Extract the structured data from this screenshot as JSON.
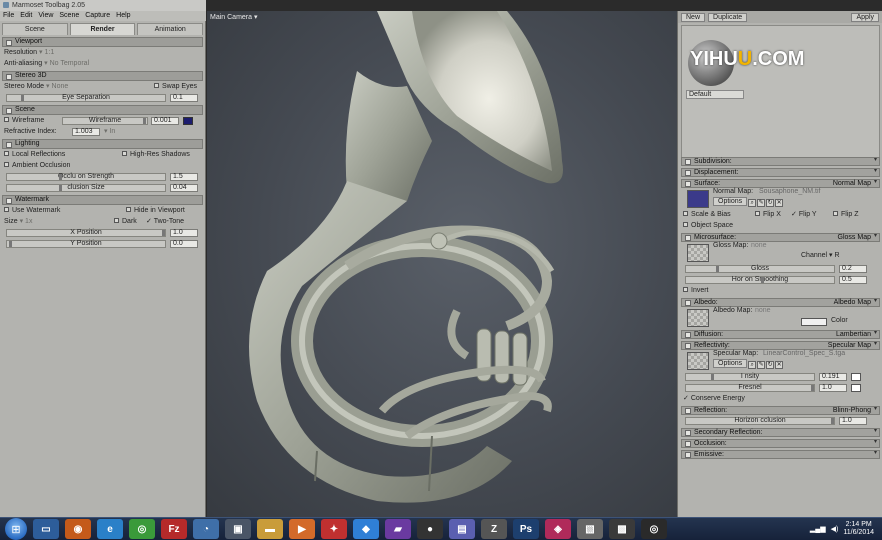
{
  "window": {
    "title": "Marmoset Toolbag 2.05"
  },
  "menu": [
    "File",
    "Edit",
    "View",
    "Scene",
    "Capture",
    "Help"
  ],
  "left_tabs": [
    {
      "label": "Scene",
      "active": false
    },
    {
      "label": "Render",
      "active": true
    },
    {
      "label": "Animation",
      "active": false
    }
  ],
  "viewport_section": {
    "header": "Viewport",
    "resolution_label": "Resolution",
    "resolution_value": "1:1",
    "antialias_label": "Anti-aliasing",
    "antialias_value": "No Temporal"
  },
  "stereo": {
    "header": "Stereo 3D",
    "mode_label": "Stereo Mode",
    "mode_value": "None",
    "swap_eyes": "Swap Eyes",
    "eye_sep_label": "Eye Separation",
    "eye_sep_value": "0.1"
  },
  "scene": {
    "header": "Scene",
    "wireframe_label": "Wireframe",
    "wireframe_field": "Wireframe",
    "wireframe_value": "0.001",
    "wire_color": "#1c1c6e",
    "refractive_label": "Refractive Index:",
    "refractive_value": "1.003",
    "refractive_unit": "In"
  },
  "lighting": {
    "header": "Lighting",
    "local_reflections": "Local Reflections",
    "high_res_shadows": "High-Res Shadows",
    "ambient_occlusion": "Ambient Occlusion",
    "occlusion_strength_label": "Occlu   on Strength",
    "occlusion_strength_value": "1.5",
    "occlusion_size_label": "   clusion Size",
    "occlusion_size_value": "0.04"
  },
  "watermark": {
    "header": "Watermark",
    "use_watermark": "Use Watermark",
    "hide_viewport": "Hide in Viewport",
    "size_label": "Size",
    "size_value": "1x",
    "dark": "Dark",
    "two_tone": "Two-Tone",
    "x_label": "X Position",
    "x_value": "1.0",
    "y_label": "Y Position",
    "y_value": "0.0"
  },
  "viewport_label": "Main Camera",
  "material_toolbar": {
    "new": "New",
    "duplicate": "Duplicate",
    "apply": "Apply"
  },
  "watermark_logo": {
    "part1": "YI",
    "part2": "HU",
    "part3": "U",
    "part4": ".COM"
  },
  "material_name": "Default",
  "sections": {
    "subdivision": "Subdivision:",
    "displacement": "Displacement:",
    "surface": "Surface:",
    "surface_mode": "Normal Map",
    "normal_map_label": "Normal Map:",
    "normal_map_value": "Sousaphone_NM.tif",
    "options": "Options",
    "scale_bias": "Scale & Bias",
    "flip_x": "Flip X",
    "flip_y": "Flip Y",
    "flip_z": "Flip Z",
    "object_space": "Object Space",
    "microsurface": "Microsurface:",
    "microsurface_mode": "Gloss Map",
    "gloss_map_label": "Gloss Map:",
    "gloss_map_value": "none",
    "channel_label": "Channel",
    "channel_value": "R",
    "gloss_label": "Gloss",
    "gloss_value": "0.2",
    "horizon_label": "Hor   on Smoothing",
    "horizon_value": "0.5",
    "invert": "Invert",
    "albedo": "Albedo:",
    "albedo_mode": "Albedo Map",
    "albedo_map_label": "Albedo Map:",
    "albedo_map_value": "none",
    "color_label": "Color",
    "diffusion": "Diffusion:",
    "diffusion_mode": "Lambertian",
    "reflectivity": "Reflectivity:",
    "reflectivity_mode": "Specular Map",
    "specular_map_label": "Specular Map:",
    "specular_map_value": "LinearControl_Spec_S.tga",
    "intensity_label": "I   nsity",
    "intensity_value": "0.191",
    "fresnel_label": "Fresnel",
    "fresnel_value": "1.0",
    "conserve_energy": "Conserve Energy",
    "reflection": "Reflection:",
    "reflection_mode": "Blinn-Phong",
    "horizon_occlusion_label": "Horizon   cclusion",
    "horizon_occlusion_value": "1.0",
    "secondary_reflection": "Secondary Reflection:",
    "occlusion": "Occlusion:",
    "emissive": "Emissive:"
  },
  "colors": {
    "normal_map_swatch": "#3b3a8a",
    "albedo_swatch": "#f0f0f0"
  },
  "taskbar": {
    "icons": [
      "windows-explorer",
      "firefox",
      "internet-explorer",
      "chrome",
      "filezilla",
      "edge",
      "media",
      "folder",
      "media-player",
      "app-red",
      "dropbox",
      "app-purple",
      "obs",
      "app-blue",
      "zbrush",
      "photoshop",
      "app-pink",
      "app-gray",
      "app-dark",
      "app-target"
    ],
    "time": "2:14 PM",
    "date": "11/6/2014"
  }
}
